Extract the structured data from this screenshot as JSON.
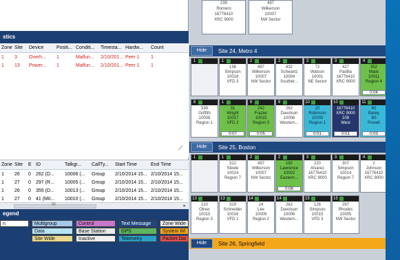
{
  "alarms": {
    "title": "stics",
    "columns": [
      "Zone",
      "Site",
      "Device",
      "Positi...",
      "Conditi...",
      "Timesta...",
      "Hardw...",
      "Count"
    ],
    "rows": [
      [
        "1",
        "3",
        "Overh...",
        "1",
        "Malfun...",
        "2/10/201...",
        "Peer 1",
        "1"
      ],
      [
        "1",
        "13",
        "Power...",
        "1",
        "Malfun...",
        "2/10/201...",
        "Peer 1",
        "1"
      ]
    ]
  },
  "calls": {
    "columns": [
      "Zone",
      "Site",
      "E",
      "ID",
      "Talkgr...",
      "CallTy...",
      "Start Time",
      "End Time"
    ],
    "rows": [
      [
        "1",
        "26",
        "0",
        "262 (D...",
        "10006 (...",
        "Group",
        "2/10/2014 15...",
        "2/10/2014 15..."
      ],
      [
        "1",
        "27",
        "0",
        "297 (R...",
        "10005 (...",
        "Group",
        "2/10/2014 15...",
        "2/10/2014 15..."
      ],
      [
        "1",
        "26",
        "0",
        "355 (D...",
        "10013 (...",
        "Group",
        "2/10/2014 15...",
        "2/10/2014 15..."
      ],
      [
        "1",
        "27",
        "0",
        "41 (Mit...",
        "10010 (...",
        "Group",
        "2/10/2014 15...",
        "2/10/2014 15..."
      ],
      [
        "1",
        "26",
        "0",
        "388 (Y...",
        "10002 (...",
        "Group",
        "2/10/2014 15...",
        "2/10/2014 15..."
      ],
      [
        "1",
        "27",
        "0",
        "69 (Gr...",
        "10012 (...",
        "Group",
        "2/10/2014 15...",
        "2/10/2014 15..."
      ],
      [
        "1",
        "26",
        "0",
        "244 (H...",
        "10014 (...",
        "Group",
        "2/10/2014 15...",
        "2/10/2014 15..."
      ]
    ],
    "scroll_mid": "III"
  },
  "legend": {
    "title": "egend",
    "items": [
      {
        "label": "n",
        "color": "#ffffff"
      },
      {
        "label": "Multigroup",
        "color": "#a6c8e8"
      },
      {
        "label": "Control",
        "color": "#c878c8"
      },
      {
        "label": "Text Message",
        "color": "#1f4780"
      },
      {
        "label": "Zone Wide",
        "color": "#e8e8e8"
      },
      {
        "label": "Data",
        "color": "#b7e4f4"
      },
      {
        "label": "Base Station",
        "color": "#eaeaea"
      },
      {
        "label": "GPS",
        "color": "#5fb45f"
      },
      {
        "label": "System Wi",
        "color": "#f5a71b"
      },
      {
        "label": "Site Wide",
        "color": "#e8d890"
      },
      {
        "label": "Inactive",
        "color": "#f0f0f0"
      },
      {
        "label": "Telemetry",
        "color": "#2aa0c8"
      },
      {
        "label": "Packet Dat",
        "color": "#e05050"
      }
    ]
  },
  "sites": {
    "hide_label": "Hide",
    "top_strip": [
      "239",
      "Romero",
      "16776410",
      "XRC 9000"
    ],
    "top_strip2": [
      "497",
      "Wilkerson",
      "10007",
      "NW Sector"
    ],
    "site24": {
      "name": "Site 24, Metro 4",
      "row1": [
        {
          "n": "1",
          "lines": [],
          "style": "gray"
        },
        {
          "n": "1",
          "lines": [
            "136",
            "Simpson",
            "10018",
            "VFD 3"
          ],
          "style": "white"
        },
        {
          "n": "2",
          "lines": [
            "497",
            "Wilkerson",
            "10007",
            "NW Sector"
          ],
          "style": "white"
        },
        {
          "n": "2",
          "lines": [
            "432",
            "Schwartz",
            "10004",
            "Souther..."
          ],
          "style": "white"
        },
        {
          "n": "3",
          "lines": [
            "72",
            "Watson",
            "10001",
            "NE Sector"
          ],
          "style": "white"
        },
        {
          "n": "3",
          "lines": [
            "427",
            "Padilla",
            "16776410",
            "XRC 9000"
          ],
          "style": "white"
        },
        {
          "n": "4",
          "lines": [
            "352",
            "Mack",
            "10011",
            "Region 4"
          ],
          "style": "green",
          "foot": "0:04"
        }
      ],
      "row2": [
        {
          "n": "8",
          "lines": [
            "339",
            "Griffith",
            "10008",
            "Region 1"
          ],
          "style": "white"
        },
        {
          "n": "1",
          "lines": [
            "31",
            "Wright",
            "10017",
            "VFD 2"
          ],
          "style": "green",
          "foot": "0:07"
        },
        {
          "n": "9",
          "lines": [
            "242",
            "Frazier",
            "10015",
            "Region 3"
          ],
          "style": "green",
          "foot": "0:05"
        },
        {
          "n": "9",
          "lines": [
            "262",
            "Davidson",
            "10006",
            "Western..."
          ],
          "style": "white"
        },
        {
          "n": "10",
          "lines": [
            "20",
            "Robinson",
            "10005",
            "Region 1"
          ],
          "style": "cyan",
          "foot": "0:01"
        },
        {
          "n": "10",
          "lines": [
            "16776410",
            "XRC 9000",
            "109",
            "West"
          ],
          "style": "navy",
          "foot": "0:01"
        },
        {
          "n": "11",
          "lines": [
            "60",
            "Bailey",
            "B5",
            "Powell"
          ],
          "style": "cyan",
          "foot": "0:03"
        }
      ]
    },
    "site25": {
      "name": "Site 25, Boston",
      "row1": [
        {
          "n": "1",
          "lines": [],
          "style": "gray"
        },
        {
          "n": "1",
          "lines": [
            "312",
            "Steele",
            "10014",
            "Region 7"
          ],
          "style": "white"
        },
        {
          "n": "2",
          "lines": [
            "497",
            "Wilkerson",
            "10007",
            "NW Sector"
          ],
          "style": "white"
        },
        {
          "n": "2",
          "lines": [
            "192",
            "Lawrence",
            "10002",
            "Eastern..."
          ],
          "style": "green",
          "foot": "0:08"
        },
        {
          "n": "3",
          "lines": [
            "220",
            "Alvarez",
            "16776410",
            "XRC 9000"
          ],
          "style": "white"
        },
        {
          "n": "3",
          "lines": [
            "307",
            "Simpson",
            "10014",
            "Region 7"
          ],
          "style": "white"
        },
        {
          "n": "4",
          "lines": [
            "2",
            "Johnson",
            "16776410",
            "XRC 9000"
          ],
          "style": "white"
        }
      ],
      "row2": [
        {
          "n": "13",
          "lines": [
            "210",
            "Oliver",
            "10015",
            "Region 3"
          ],
          "style": "white"
        },
        {
          "n": "13",
          "lines": [
            "329",
            "Schneider",
            "10016",
            "VFD 1"
          ],
          "style": "white"
        },
        {
          "n": "14",
          "lines": [
            "24",
            "Lee",
            "10009",
            "Region 2"
          ],
          "style": "white"
        },
        {
          "n": "14",
          "lines": [
            "262",
            "Davidson",
            "10006",
            "Western..."
          ],
          "style": "white"
        },
        {
          "n": "15",
          "lines": [
            "126",
            "Simpson",
            "10015",
            "VFD 3"
          ],
          "style": "white"
        },
        {
          "n": "15",
          "lines": [
            "297",
            "Rhodes",
            "10005",
            "NW Sector"
          ],
          "style": "white"
        }
      ]
    },
    "site26": {
      "name": "Site 26, Springfield"
    }
  }
}
